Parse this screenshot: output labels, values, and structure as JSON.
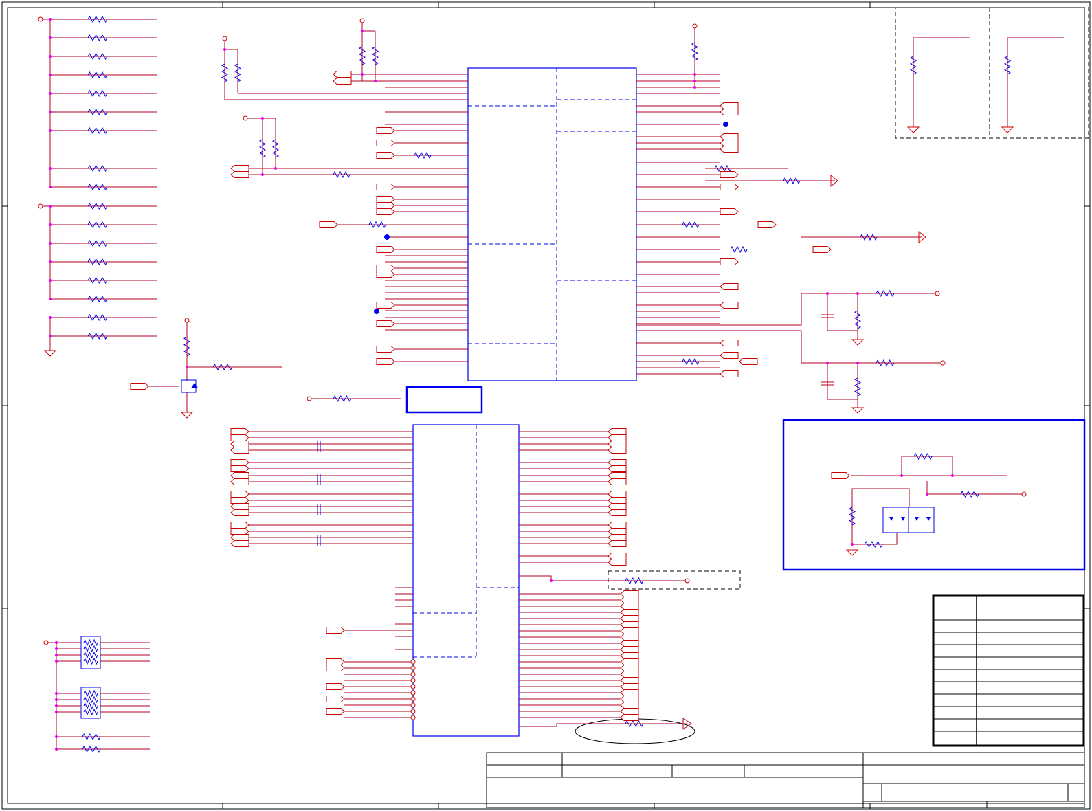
{
  "sheet": {
    "zones": 5,
    "rows": 3
  },
  "colors": {
    "wire": "#b00020",
    "net": "#cc0000",
    "part": "#0000ee",
    "junction": "#ee00ee",
    "frame": "#000000",
    "grid": "#333333"
  },
  "title_block": {
    "revision_rows": 10
  },
  "icons": [
    "resistor-icon",
    "capacitor-icon",
    "ground-icon",
    "power-port-icon",
    "net-label-icon",
    "mosfet-icon",
    "diode-icon",
    "resistor-network-icon",
    "no-connect-icon"
  ]
}
